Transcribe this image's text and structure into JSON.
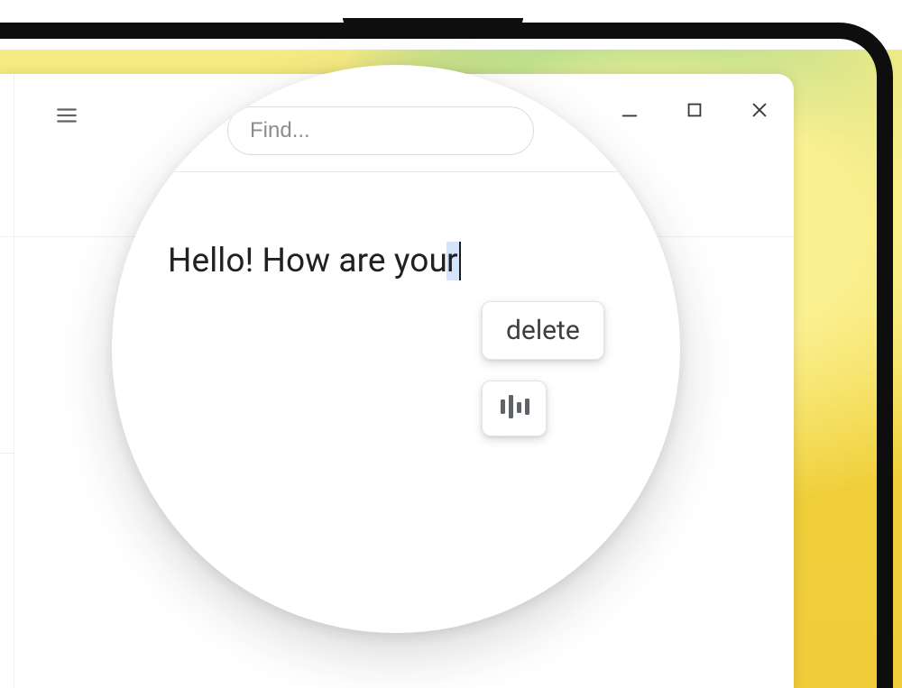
{
  "search": {
    "placeholder": "Find..."
  },
  "editor": {
    "text_before_selection": "Hello! How are you",
    "selected_char": "r"
  },
  "popup": {
    "delete_label": "delete"
  },
  "icons": {
    "hamburger": "menu-icon",
    "minimize": "minimize-icon",
    "maximize": "maximize-icon",
    "close": "close-icon",
    "dictate": "dictate-icon"
  }
}
